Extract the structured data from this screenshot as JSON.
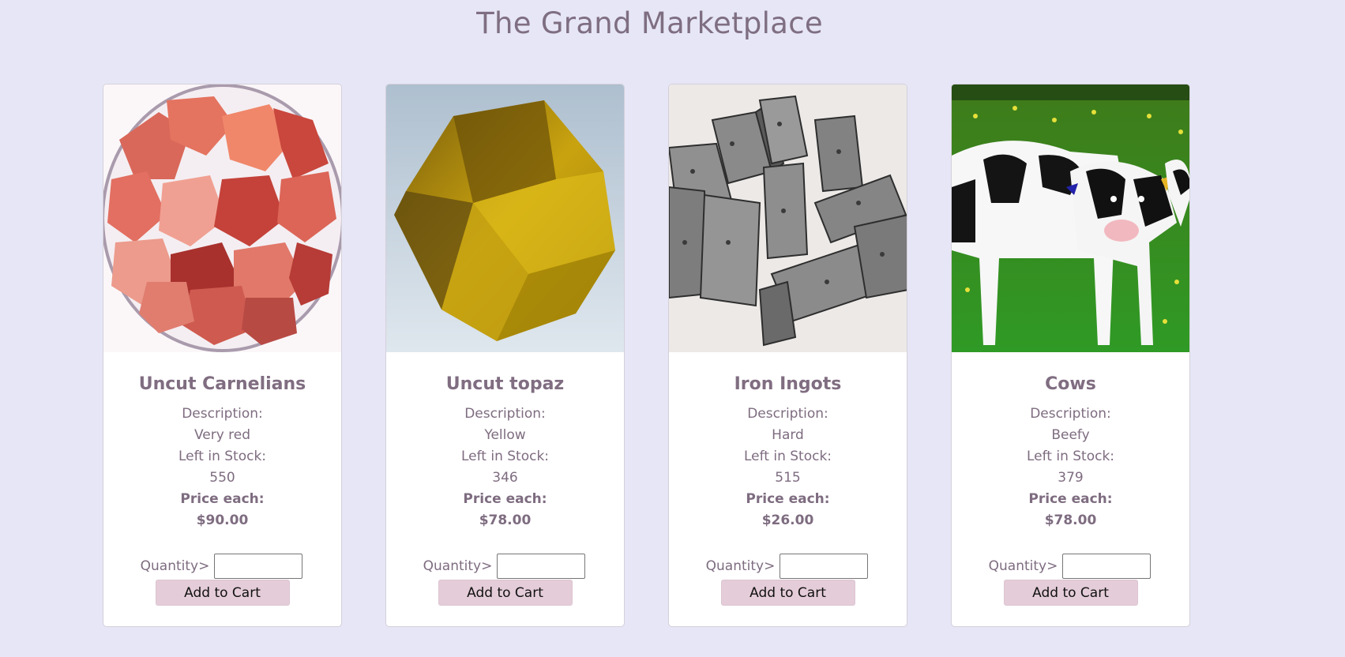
{
  "page": {
    "title": "The Grand Marketplace"
  },
  "products": [
    {
      "name": "Uncut Carnelians",
      "description_label": "Description:",
      "description": "Very red",
      "stock_label": "Left in Stock:",
      "stock": "550",
      "price_label": "Price each:",
      "price": "$90.00",
      "quantity_label": "Quantity>",
      "quantity_value": "",
      "button_label": "Add to Cart",
      "image_icon": "carnelian-stones-image"
    },
    {
      "name": "Uncut topaz",
      "description_label": "Description:",
      "description": "Yellow",
      "stock_label": "Left in Stock:",
      "stock": "346",
      "price_label": "Price each:",
      "price": "$78.00",
      "quantity_label": "Quantity>",
      "quantity_value": "",
      "button_label": "Add to Cart",
      "image_icon": "topaz-crystal-image"
    },
    {
      "name": "Iron Ingots",
      "description_label": "Description:",
      "description": "Hard",
      "stock_label": "Left in Stock:",
      "stock": "515",
      "price_label": "Price each:",
      "price": "$26.00",
      "quantity_label": "Quantity>",
      "quantity_value": "",
      "button_label": "Add to Cart",
      "image_icon": "iron-ingots-image"
    },
    {
      "name": "Cows",
      "description_label": "Description:",
      "description": "Beefy",
      "stock_label": "Left in Stock:",
      "stock": "379",
      "price_label": "Price each:",
      "price": "$78.00",
      "quantity_label": "Quantity>",
      "quantity_value": "",
      "button_label": "Add to Cart",
      "image_icon": "cows-image"
    }
  ],
  "colors": {
    "background": "#e6e6f6",
    "text": "#7e6c80",
    "button": "#e4ccd8",
    "card": "#ffffff"
  }
}
